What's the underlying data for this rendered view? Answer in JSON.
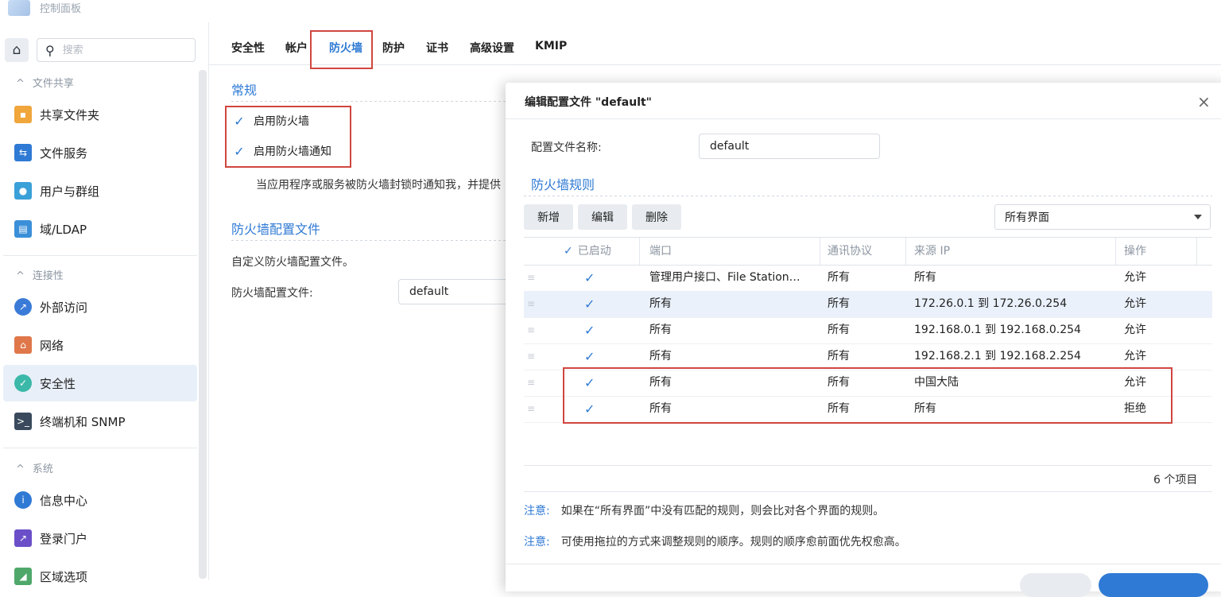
{
  "app": {
    "title": "控制面板"
  },
  "sidebar": {
    "search_placeholder": "搜索",
    "groups": [
      {
        "label": "文件共享"
      },
      {
        "label": "连接性"
      },
      {
        "label": "系统"
      }
    ],
    "items": [
      {
        "label": "共享文件夹"
      },
      {
        "label": "文件服务"
      },
      {
        "label": "用户与群组"
      },
      {
        "label": "域/LDAP"
      },
      {
        "label": "外部访问"
      },
      {
        "label": "网络"
      },
      {
        "label": "安全性"
      },
      {
        "label": "终端机和 SNMP"
      },
      {
        "label": "信息中心"
      },
      {
        "label": "登录门户"
      },
      {
        "label": "区域选项"
      }
    ]
  },
  "tabs": [
    {
      "label": "安全性"
    },
    {
      "label": "帐户"
    },
    {
      "label": "防火墙"
    },
    {
      "label": "防护"
    },
    {
      "label": "证书"
    },
    {
      "label": "高级设置"
    },
    {
      "label": "KMIP"
    }
  ],
  "general": {
    "title": "常规",
    "enable_firewall": "启用防火墙",
    "enable_notify": "启用防火墙通知",
    "notify_desc": "当应用程序或服务被防火墙封锁时通知我，并提供"
  },
  "profile": {
    "title": "防火墙配置文件",
    "desc": "自定义防火墙配置文件。",
    "label": "防火墙配置文件:",
    "value": "default"
  },
  "dialog": {
    "title": "编辑配置文件 \"default\"",
    "close": "×",
    "name_label": "配置文件名称:",
    "name_value": "default",
    "rules_title": "防火墙规则",
    "buttons": {
      "add": "新增",
      "edit": "编辑",
      "delete": "删除"
    },
    "interface_select": "所有界面",
    "columns": {
      "enabled": "已启动",
      "port": "端口",
      "protocol": "通讯协议",
      "source": "来源 IP",
      "action": "操作"
    },
    "rows": [
      {
        "port": "管理用户接口、File Station…",
        "protocol": "所有",
        "source": "所有",
        "action": "允许"
      },
      {
        "port": "所有",
        "protocol": "所有",
        "source": "172.26.0.1 到 172.26.0.254",
        "action": "允许"
      },
      {
        "port": "所有",
        "protocol": "所有",
        "source": "192.168.0.1 到 192.168.0.254",
        "action": "允许"
      },
      {
        "port": "所有",
        "protocol": "所有",
        "source": "192.168.2.1 到 192.168.2.254",
        "action": "允许"
      },
      {
        "port": "所有",
        "protocol": "所有",
        "source": "中国大陆",
        "action": "允许"
      },
      {
        "port": "所有",
        "protocol": "所有",
        "source": "所有",
        "action": "拒绝"
      }
    ],
    "count": "6 个项目",
    "note_lead": "注意:",
    "note1": "如果在“所有界面”中没有匹配的规则，则会比对各个界面的规则。",
    "note2": "可使用拖拉的方式来调整规则的顺序。规则的顺序愈前面优先权愈高。"
  },
  "colors": {
    "accent": "#2f7ad4",
    "highlight": "#d0463f"
  }
}
